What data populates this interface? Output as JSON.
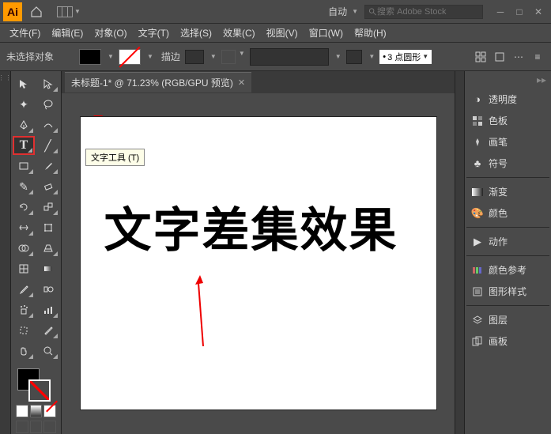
{
  "titlebar": {
    "logo": "Ai",
    "auto_label": "自动",
    "search_placeholder": "搜索 Adobe Stock"
  },
  "menu": {
    "file": "文件(F)",
    "edit": "编辑(E)",
    "object": "对象(O)",
    "type": "文字(T)",
    "select": "选择(S)",
    "effect": "效果(C)",
    "view": "视图(V)",
    "window": "窗口(W)",
    "help": "帮助(H)"
  },
  "control": {
    "no_selection": "未选择对象",
    "stroke_label": "描边",
    "style_label": "3 点圆形"
  },
  "doc": {
    "tab_title": "未标题-1* @ 71.23% (RGB/GPU 预览)",
    "artboard_text": "文字差集效果"
  },
  "tooltip": {
    "type_tool": "文字工具 (T)"
  },
  "panels": {
    "transparency": "透明度",
    "swatches": "色板",
    "brushes": "画笔",
    "symbols": "符号",
    "gradient": "渐变",
    "color": "颜色",
    "actions": "动作",
    "color_guide": "颜色参考",
    "graphic_styles": "图形样式",
    "layers": "图层",
    "artboards": "画板"
  }
}
